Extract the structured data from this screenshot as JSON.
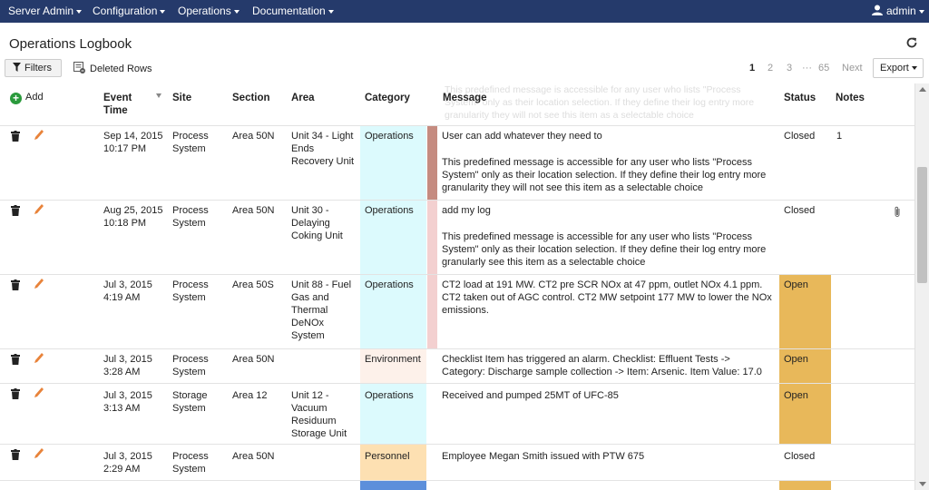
{
  "nav": {
    "menus": [
      "Server Admin",
      "Configuration",
      "Operations",
      "Documentation"
    ],
    "user": "admin"
  },
  "page": {
    "title": "Operations Logbook"
  },
  "toolbar": {
    "filters": "Filters",
    "deleted_rows": "Deleted Rows",
    "pages": [
      "1",
      "2",
      "3",
      "···",
      "65"
    ],
    "next": "Next",
    "export": "Export"
  },
  "table": {
    "add": "Add",
    "headers": {
      "event_time": "Event Time",
      "site": "Site",
      "section": "Section",
      "area": "Area",
      "category": "Category",
      "message": "Message",
      "status": "Status",
      "notes": "Notes"
    },
    "ghost_text": "This predefined message is accessible for any user who lists \"Process System\" only as their location selection. If they define their log entry more granularity they will not see this item as a selectable choice",
    "rows": [
      {
        "event_time": "Sep 14, 2015 10:17 PM",
        "site": "Process System",
        "section": "Area 50N",
        "area": "Unit 34 - Light Ends Recovery Unit",
        "category": "Operations",
        "message_title": "User can add whatever they need to",
        "message_body": "This predefined message is accessible for any user who lists \"Process System\" only as their location selection. If they define their log entry more granularity they will not see this item as a selectable choice",
        "status": "Closed",
        "notes": "1"
      },
      {
        "event_time": "Aug 25, 2015 10:18 PM",
        "site": "Process System",
        "section": "Area 50N",
        "area": "Unit 30 - Delaying Coking Unit",
        "category": "Operations",
        "message_title": "add my log",
        "message_body": "This predefined message is accessible for any user who lists \"Process System\" only as their location selection. If they define their log entry more granularly  see this item as a selectable choice",
        "status": "Closed",
        "notes": ""
      },
      {
        "event_time": "Jul 3, 2015 4:19 AM",
        "site": "Process System",
        "section": "Area 50S",
        "area": "Unit 88 - Fuel Gas and Thermal DeNOx System",
        "category": "Operations",
        "message_title": "CT2 load at 191 MW. CT2 pre SCR NOx at 47 ppm, outlet NOx 4.1 ppm. CT2 taken out of AGC control. CT2 MW setpoint 177 MW to lower the NOx emissions.",
        "message_body": "",
        "status": "Open",
        "notes": ""
      },
      {
        "event_time": "Jul 3, 2015 3:28 AM",
        "site": "Process System",
        "section": "Area 50N",
        "area": "",
        "category": "Environment",
        "message_title": "Checklist Item has triggered an alarm. Checklist: Effluent Tests -> Category: Discharge sample collection -> Item: Arsenic. Item Value: 17.0",
        "message_body": "",
        "status": "Open",
        "notes": ""
      },
      {
        "event_time": "Jul 3, 2015 3:13 AM",
        "site": "Storage System",
        "section": "Area 12",
        "area": "Unit 12 - Vacuum Residuum Storage Unit",
        "category": "Operations",
        "message_title": "Received and pumped 25MT of UFC-85",
        "message_body": "",
        "status": "Open",
        "notes": ""
      },
      {
        "event_time": "Jul 3, 2015 2:29 AM",
        "site": "Process System",
        "section": "Area 50N",
        "area": "",
        "category": "Personnel",
        "message_title": "Employee Megan Smith issued with PTW 675",
        "message_body": "",
        "status": "Closed",
        "notes": ""
      }
    ]
  },
  "colors": {
    "nav_bg": "#253a6b",
    "cat_operations": "#dcfafd",
    "cat_environment": "#fdf1ea",
    "cat_personnel": "#fde0b2",
    "cat_next": "#5c8fdb",
    "status_open": "#e8b85a",
    "strip_1": "#c58b80",
    "strip_pink": "#f3d0d0",
    "add_green": "#2a9a3c"
  }
}
